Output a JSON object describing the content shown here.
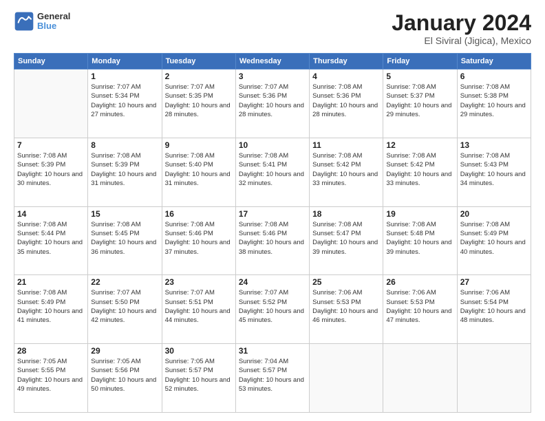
{
  "header": {
    "logo_line1": "General",
    "logo_line2": "Blue",
    "title": "January 2024",
    "subtitle": "El Siviral (Jigica), Mexico"
  },
  "days_of_week": [
    "Sunday",
    "Monday",
    "Tuesday",
    "Wednesday",
    "Thursday",
    "Friday",
    "Saturday"
  ],
  "weeks": [
    [
      {
        "day": "",
        "sunrise": "",
        "sunset": "",
        "daylight": ""
      },
      {
        "day": "1",
        "sunrise": "Sunrise: 7:07 AM",
        "sunset": "Sunset: 5:34 PM",
        "daylight": "Daylight: 10 hours and 27 minutes."
      },
      {
        "day": "2",
        "sunrise": "Sunrise: 7:07 AM",
        "sunset": "Sunset: 5:35 PM",
        "daylight": "Daylight: 10 hours and 28 minutes."
      },
      {
        "day": "3",
        "sunrise": "Sunrise: 7:07 AM",
        "sunset": "Sunset: 5:36 PM",
        "daylight": "Daylight: 10 hours and 28 minutes."
      },
      {
        "day": "4",
        "sunrise": "Sunrise: 7:08 AM",
        "sunset": "Sunset: 5:36 PM",
        "daylight": "Daylight: 10 hours and 28 minutes."
      },
      {
        "day": "5",
        "sunrise": "Sunrise: 7:08 AM",
        "sunset": "Sunset: 5:37 PM",
        "daylight": "Daylight: 10 hours and 29 minutes."
      },
      {
        "day": "6",
        "sunrise": "Sunrise: 7:08 AM",
        "sunset": "Sunset: 5:38 PM",
        "daylight": "Daylight: 10 hours and 29 minutes."
      }
    ],
    [
      {
        "day": "7",
        "sunrise": "Sunrise: 7:08 AM",
        "sunset": "Sunset: 5:39 PM",
        "daylight": "Daylight: 10 hours and 30 minutes."
      },
      {
        "day": "8",
        "sunrise": "Sunrise: 7:08 AM",
        "sunset": "Sunset: 5:39 PM",
        "daylight": "Daylight: 10 hours and 31 minutes."
      },
      {
        "day": "9",
        "sunrise": "Sunrise: 7:08 AM",
        "sunset": "Sunset: 5:40 PM",
        "daylight": "Daylight: 10 hours and 31 minutes."
      },
      {
        "day": "10",
        "sunrise": "Sunrise: 7:08 AM",
        "sunset": "Sunset: 5:41 PM",
        "daylight": "Daylight: 10 hours and 32 minutes."
      },
      {
        "day": "11",
        "sunrise": "Sunrise: 7:08 AM",
        "sunset": "Sunset: 5:42 PM",
        "daylight": "Daylight: 10 hours and 33 minutes."
      },
      {
        "day": "12",
        "sunrise": "Sunrise: 7:08 AM",
        "sunset": "Sunset: 5:42 PM",
        "daylight": "Daylight: 10 hours and 33 minutes."
      },
      {
        "day": "13",
        "sunrise": "Sunrise: 7:08 AM",
        "sunset": "Sunset: 5:43 PM",
        "daylight": "Daylight: 10 hours and 34 minutes."
      }
    ],
    [
      {
        "day": "14",
        "sunrise": "Sunrise: 7:08 AM",
        "sunset": "Sunset: 5:44 PM",
        "daylight": "Daylight: 10 hours and 35 minutes."
      },
      {
        "day": "15",
        "sunrise": "Sunrise: 7:08 AM",
        "sunset": "Sunset: 5:45 PM",
        "daylight": "Daylight: 10 hours and 36 minutes."
      },
      {
        "day": "16",
        "sunrise": "Sunrise: 7:08 AM",
        "sunset": "Sunset: 5:46 PM",
        "daylight": "Daylight: 10 hours and 37 minutes."
      },
      {
        "day": "17",
        "sunrise": "Sunrise: 7:08 AM",
        "sunset": "Sunset: 5:46 PM",
        "daylight": "Daylight: 10 hours and 38 minutes."
      },
      {
        "day": "18",
        "sunrise": "Sunrise: 7:08 AM",
        "sunset": "Sunset: 5:47 PM",
        "daylight": "Daylight: 10 hours and 39 minutes."
      },
      {
        "day": "19",
        "sunrise": "Sunrise: 7:08 AM",
        "sunset": "Sunset: 5:48 PM",
        "daylight": "Daylight: 10 hours and 39 minutes."
      },
      {
        "day": "20",
        "sunrise": "Sunrise: 7:08 AM",
        "sunset": "Sunset: 5:49 PM",
        "daylight": "Daylight: 10 hours and 40 minutes."
      }
    ],
    [
      {
        "day": "21",
        "sunrise": "Sunrise: 7:08 AM",
        "sunset": "Sunset: 5:49 PM",
        "daylight": "Daylight: 10 hours and 41 minutes."
      },
      {
        "day": "22",
        "sunrise": "Sunrise: 7:07 AM",
        "sunset": "Sunset: 5:50 PM",
        "daylight": "Daylight: 10 hours and 42 minutes."
      },
      {
        "day": "23",
        "sunrise": "Sunrise: 7:07 AM",
        "sunset": "Sunset: 5:51 PM",
        "daylight": "Daylight: 10 hours and 44 minutes."
      },
      {
        "day": "24",
        "sunrise": "Sunrise: 7:07 AM",
        "sunset": "Sunset: 5:52 PM",
        "daylight": "Daylight: 10 hours and 45 minutes."
      },
      {
        "day": "25",
        "sunrise": "Sunrise: 7:06 AM",
        "sunset": "Sunset: 5:53 PM",
        "daylight": "Daylight: 10 hours and 46 minutes."
      },
      {
        "day": "26",
        "sunrise": "Sunrise: 7:06 AM",
        "sunset": "Sunset: 5:53 PM",
        "daylight": "Daylight: 10 hours and 47 minutes."
      },
      {
        "day": "27",
        "sunrise": "Sunrise: 7:06 AM",
        "sunset": "Sunset: 5:54 PM",
        "daylight": "Daylight: 10 hours and 48 minutes."
      }
    ],
    [
      {
        "day": "28",
        "sunrise": "Sunrise: 7:05 AM",
        "sunset": "Sunset: 5:55 PM",
        "daylight": "Daylight: 10 hours and 49 minutes."
      },
      {
        "day": "29",
        "sunrise": "Sunrise: 7:05 AM",
        "sunset": "Sunset: 5:56 PM",
        "daylight": "Daylight: 10 hours and 50 minutes."
      },
      {
        "day": "30",
        "sunrise": "Sunrise: 7:05 AM",
        "sunset": "Sunset: 5:57 PM",
        "daylight": "Daylight: 10 hours and 52 minutes."
      },
      {
        "day": "31",
        "sunrise": "Sunrise: 7:04 AM",
        "sunset": "Sunset: 5:57 PM",
        "daylight": "Daylight: 10 hours and 53 minutes."
      },
      {
        "day": "",
        "sunrise": "",
        "sunset": "",
        "daylight": ""
      },
      {
        "day": "",
        "sunrise": "",
        "sunset": "",
        "daylight": ""
      },
      {
        "day": "",
        "sunrise": "",
        "sunset": "",
        "daylight": ""
      }
    ]
  ]
}
